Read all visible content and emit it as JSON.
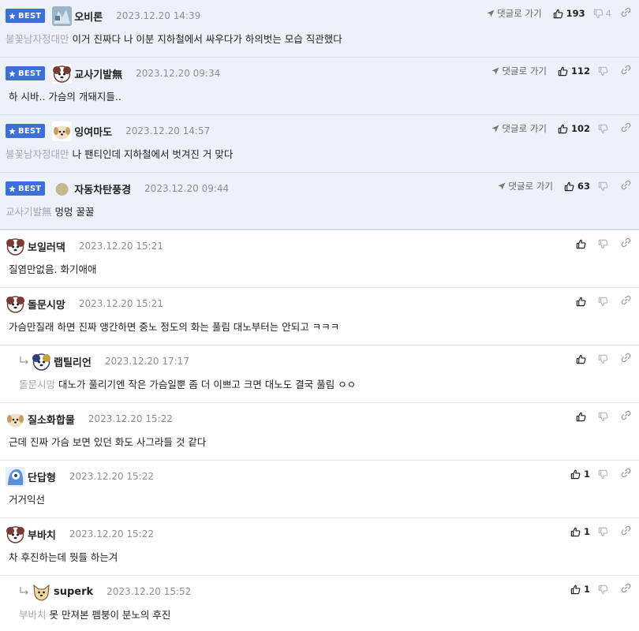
{
  "best_badge": "BEST",
  "goto_label": "댓글로 가기",
  "comments": [
    {
      "nick": "오비론",
      "date": "2023.12.20 14:39",
      "mention": "불꽃남자정대만",
      "text": "이거 진짜다 나 이분 지하철에서 싸우다가 하의벗는 모습 직관했다",
      "up": "193",
      "down": "4"
    },
    {
      "nick": "교사기발無",
      "date": "2023.12.20 09:34",
      "mention": "",
      "text": "하 시바.. 가슴의 개돼지들..",
      "up": "112",
      "down": ""
    },
    {
      "nick": "잉여마도",
      "date": "2023.12.20 14:57",
      "mention": "불꽃남자정대만",
      "text": "나 팬티인데 지하철에서 벗겨진 거 맞다",
      "up": "102",
      "down": ""
    },
    {
      "nick": "자동차탄풍경",
      "date": "2023.12.20 09:44",
      "mention": "교사기발無",
      "text": "멍멍 꿀꿀",
      "up": "63",
      "down": ""
    },
    {
      "nick": "보일러댁",
      "date": "2023.12.20 15:21",
      "mention": "",
      "text": "질염만없음. 화기애애",
      "up": "",
      "down": ""
    },
    {
      "nick": "돌문시망",
      "date": "2023.12.20 15:21",
      "mention": "",
      "text": "가슴만질래 하면 진짜 앵간하면 중노 정도의 화는 풀림 대노부터는 안되고 ㅋㅋㅋ",
      "up": "",
      "down": ""
    },
    {
      "nick": "랩틸리언",
      "date": "2023.12.20 17:17",
      "mention": "돌문시망",
      "text": "대노가 풀리기엔 작은 가슴일뿐 좀 더 이쁘고 크면 대노도 결국 풀림 ㅇㅇ",
      "up": "",
      "down": ""
    },
    {
      "nick": "질소화합물",
      "date": "2023.12.20 15:22",
      "mention": "",
      "text": "근데 진짜 가슴 보면 있던 화도 사그라들 것 같다",
      "up": "",
      "down": ""
    },
    {
      "nick": "단답형",
      "date": "2023.12.20 15:22",
      "mention": "",
      "text": "거거익선",
      "up": "1",
      "down": ""
    },
    {
      "nick": "부바치",
      "date": "2023.12.20 15:22",
      "mention": "",
      "text": "차 후진하는데 뭣들 하는겨",
      "up": "1",
      "down": ""
    },
    {
      "nick": "superk",
      "date": "2023.12.20 15:52",
      "mention": "부바치",
      "text": "못 만져본 펨붕이 분노의 후진",
      "up": "1",
      "down": ""
    }
  ]
}
